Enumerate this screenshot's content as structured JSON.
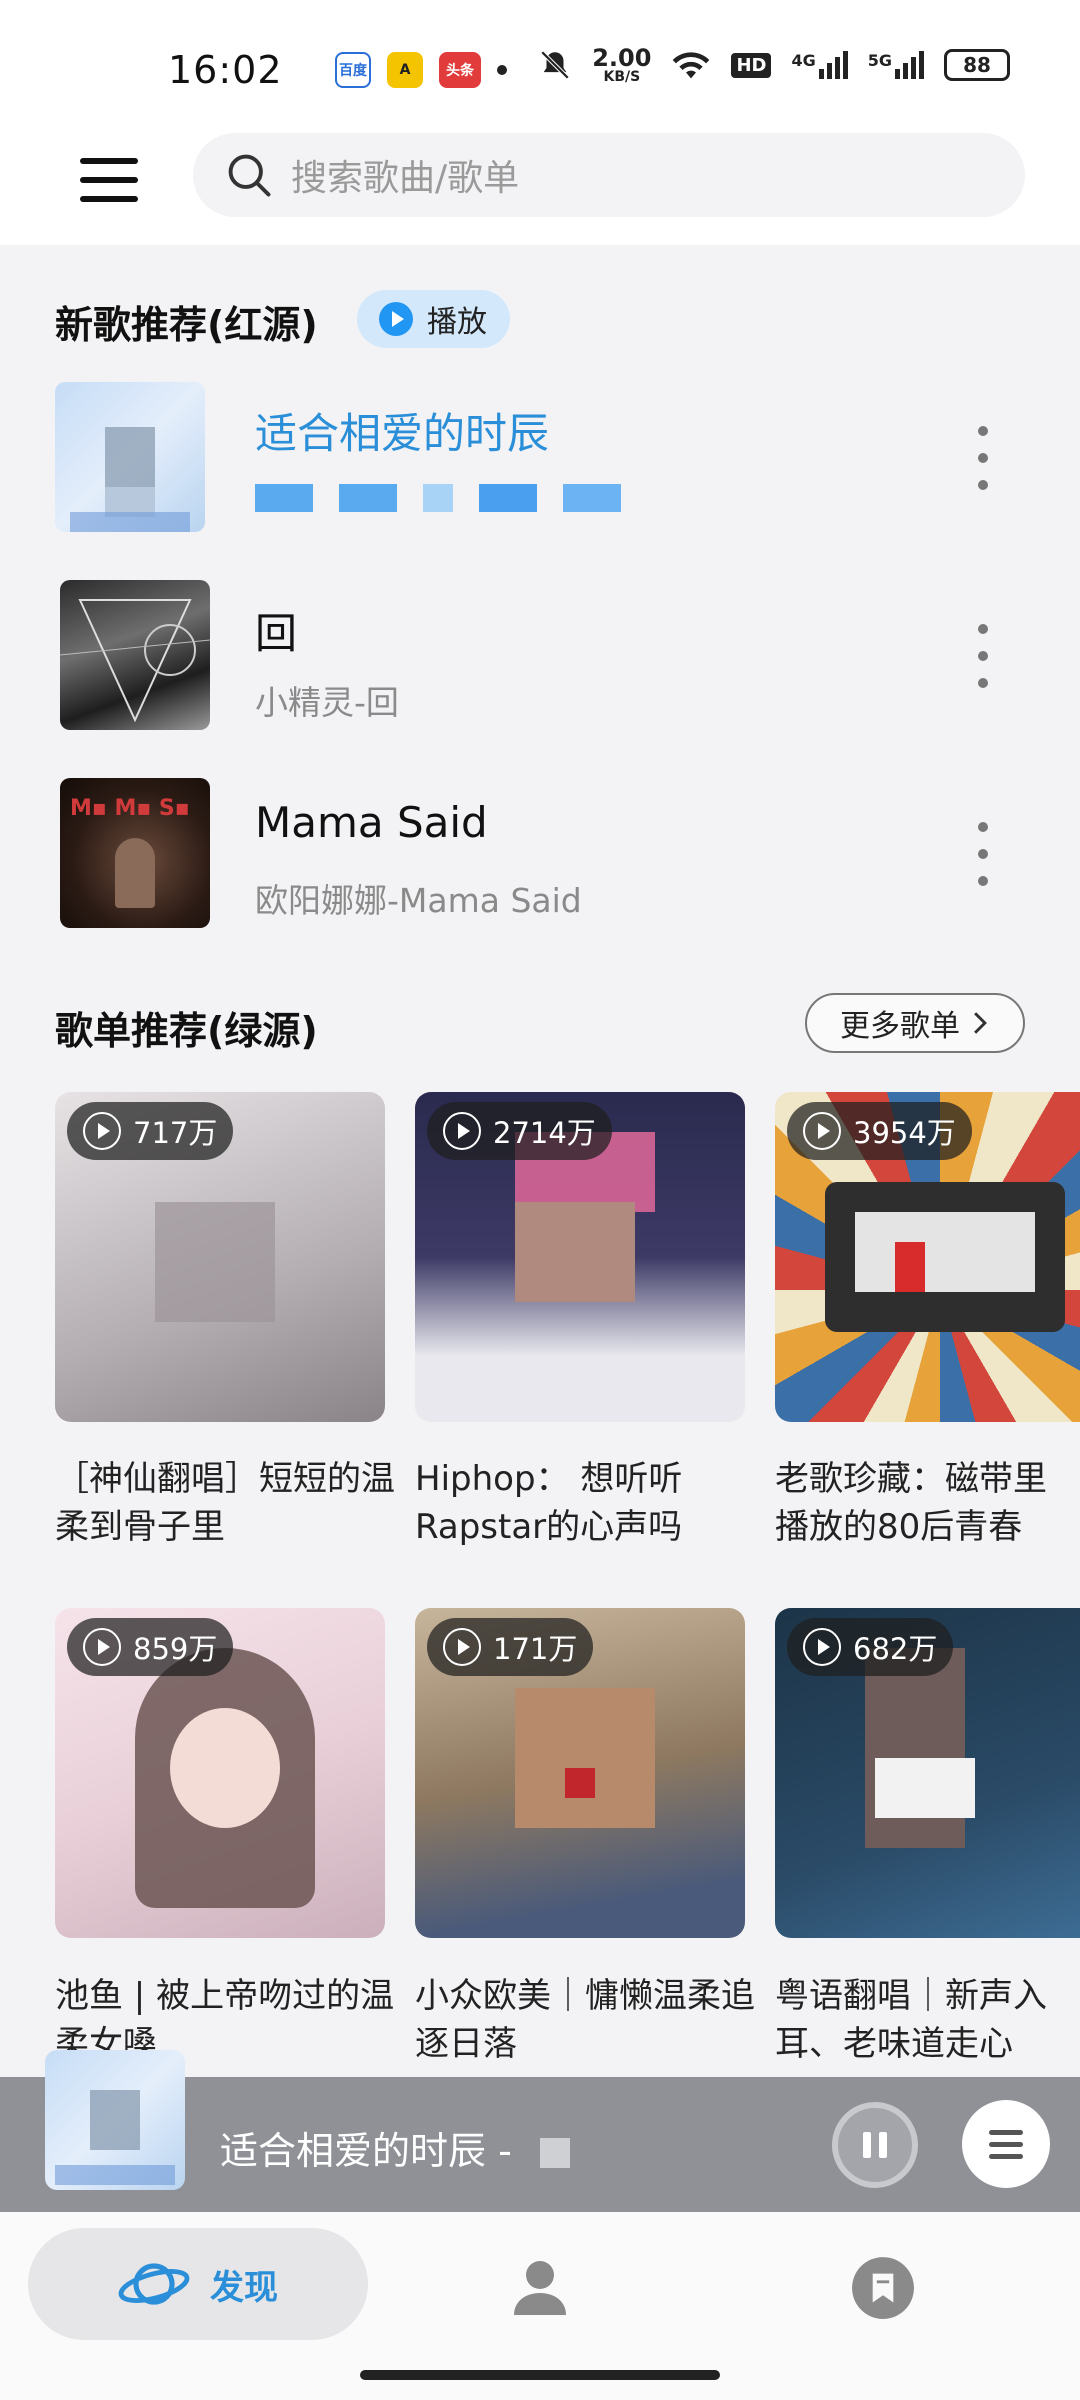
{
  "status_bar": {
    "time": "16:02",
    "app_badges": [
      "百度",
      "A",
      "头条"
    ],
    "net_speed_value": "2.00",
    "net_speed_unit": "KB/S",
    "hd": "HD",
    "sig1": "4G",
    "sig2": "5G",
    "battery": "88"
  },
  "header": {
    "search_placeholder": "搜索歌曲/歌单"
  },
  "new_songs": {
    "title": "新歌推荐(红源)",
    "play_label": "播放",
    "items": [
      {
        "title": "适合相爱的时辰",
        "subtitle": "",
        "active": true
      },
      {
        "title": "回",
        "subtitle": "小精灵-回",
        "active": false
      },
      {
        "title": "Mama Said",
        "subtitle": "欧阳娜娜-Mama Said",
        "active": false
      }
    ]
  },
  "playlists": {
    "title": "歌单推荐(绿源)",
    "more_label": "更多歌单",
    "items": [
      {
        "count": "717万",
        "name": "［神仙翻唱］短短的温柔到骨子里"
      },
      {
        "count": "2714万",
        "name": "Hiphop： 想听听Rapstar的心声吗"
      },
      {
        "count": "3954万",
        "name": "老歌珍藏：磁带里播放的80后青春"
      },
      {
        "count": "859万",
        "name": "池鱼 | 被上帝吻过的温柔女嗓"
      },
      {
        "count": "171万",
        "name": "小众欧美｜慵懒温柔追逐日落"
      },
      {
        "count": "682万",
        "name": "粤语翻唱｜新声入耳、老味道走心"
      }
    ]
  },
  "mini_player": {
    "title": "适合相爱的时辰 -"
  },
  "bottom_nav": {
    "discover_label": "发现"
  }
}
